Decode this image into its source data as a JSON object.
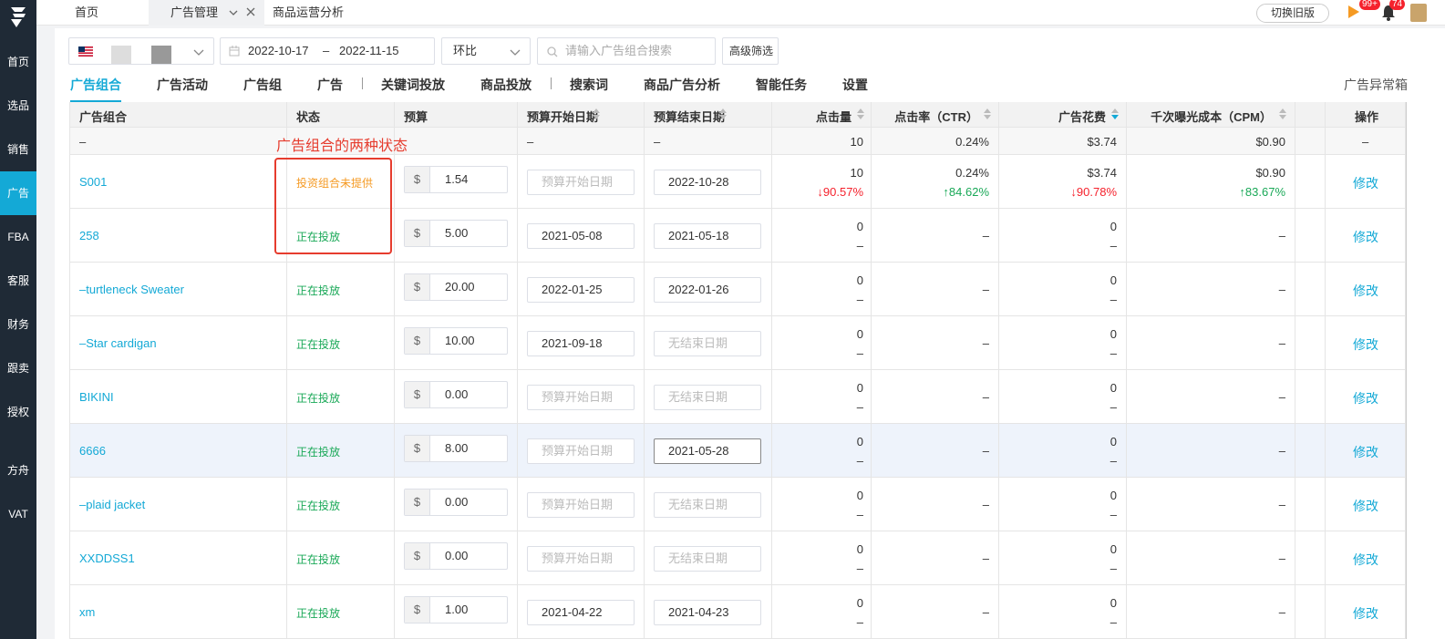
{
  "sidebar": {
    "items": [
      {
        "label": "首页"
      },
      {
        "label": "选品"
      },
      {
        "label": "销售"
      },
      {
        "label": "广告"
      },
      {
        "label": "FBA"
      },
      {
        "label": "客服"
      },
      {
        "label": "财务"
      },
      {
        "label": "跟卖"
      },
      {
        "label": "授权"
      },
      {
        "label": "方舟"
      },
      {
        "label": "VAT"
      }
    ],
    "active": "广告"
  },
  "topbar": {
    "tabs": [
      {
        "label": "首页"
      },
      {
        "label": "广告管理"
      },
      {
        "label": "商品运营分析"
      }
    ],
    "active_tab": "广告管理",
    "switch_old": "切换旧版",
    "badge_a": "99+",
    "badge_b": "74"
  },
  "filters": {
    "date_start": "2022-10-17",
    "date_sep": "–",
    "date_end": "2022-11-15",
    "compare": "环比",
    "search_placeholder": "请输入广告组合搜索",
    "advanced": "高级筛选"
  },
  "subtabs": [
    "广告组合",
    "广告活动",
    "广告组",
    "广告",
    "关键词投放",
    "商品投放",
    "搜索词",
    "商品广告分析",
    "智能任务",
    "设置"
  ],
  "active_subtab": "广告组合",
  "anomaly_box": "广告异常箱",
  "table": {
    "headers": {
      "portfolio": "广告组合",
      "status": "状态",
      "budget": "预算",
      "start": "预算开始日期",
      "end": "预算结束日期",
      "clicks": "点击量",
      "ctr": "点击率（CTR）",
      "spend": "广告花费",
      "cpm": "千次曝光成本（CPM）",
      "ops": "操作"
    },
    "summary": {
      "portfolio": "–",
      "start": "–",
      "end": "–",
      "clicks": "10",
      "ctr": "0.24%",
      "spend": "$3.74",
      "cpm": "$0.90",
      "ops": "–"
    },
    "currency": "$",
    "edit_label": "修改",
    "rows": [
      {
        "name": "S001",
        "status": "投资组合未提供",
        "status_type": "orange",
        "budget": "1.54",
        "start": "预算开始日期",
        "start_ph": true,
        "end": "2022-10-28",
        "end_ph": false,
        "clicks": "10",
        "clicks_cmp": "↓90.57%",
        "clicks_dir": "down",
        "ctr": "0.24%",
        "ctr_cmp": "↑84.62%",
        "ctr_dir": "up",
        "spend": "$3.74",
        "spend_cmp": "↓90.78%",
        "spend_dir": "down",
        "cpm": "$0.90",
        "cpm_cmp": "↑83.67%",
        "cpm_dir": "up"
      },
      {
        "name": "258",
        "status": "正在投放",
        "status_type": "green",
        "budget": "5.00",
        "start": "2021-05-08",
        "start_ph": false,
        "end": "2021-05-18",
        "end_ph": false,
        "clicks": "0",
        "clicks_cmp": "–",
        "ctr": "–",
        "spend": "0",
        "spend_cmp": "–",
        "cpm": "–"
      },
      {
        "name": "–turtleneck Sweater",
        "status": "正在投放",
        "status_type": "green",
        "budget": "20.00",
        "start": "2022-01-25",
        "start_ph": false,
        "end": "2022-01-26",
        "end_ph": false,
        "clicks": "0",
        "clicks_cmp": "–",
        "ctr": "–",
        "spend": "0",
        "spend_cmp": "–",
        "cpm": "–"
      },
      {
        "name": "–Star cardigan",
        "status": "正在投放",
        "status_type": "green",
        "budget": "10.00",
        "start": "2021-09-18",
        "start_ph": false,
        "end": "无结束日期",
        "end_ph": true,
        "clicks": "0",
        "clicks_cmp": "–",
        "ctr": "–",
        "spend": "0",
        "spend_cmp": "–",
        "cpm": "–"
      },
      {
        "name": "BIKINI",
        "status": "正在投放",
        "status_type": "green",
        "budget": "0.00",
        "start": "预算开始日期",
        "start_ph": true,
        "end": "无结束日期",
        "end_ph": true,
        "clicks": "0",
        "clicks_cmp": "–",
        "ctr": "–",
        "spend": "0",
        "spend_cmp": "–",
        "cpm": "–"
      },
      {
        "name": "6666",
        "status": "正在投放",
        "status_type": "green",
        "budget": "8.00",
        "start": "预算开始日期",
        "start_ph": true,
        "end": "2021-05-28",
        "end_ph": false,
        "clicks": "0",
        "clicks_cmp": "–",
        "ctr": "–",
        "spend": "0",
        "spend_cmp": "–",
        "cpm": "–",
        "highlight": true
      },
      {
        "name": "–plaid jacket",
        "status": "正在投放",
        "status_type": "green",
        "budget": "0.00",
        "start": "预算开始日期",
        "start_ph": true,
        "end": "无结束日期",
        "end_ph": true,
        "clicks": "0",
        "clicks_cmp": "–",
        "ctr": "–",
        "spend": "0",
        "spend_cmp": "–",
        "cpm": "–"
      },
      {
        "name": "XXDDSS1",
        "status": "正在投放",
        "status_type": "green",
        "budget": "0.00",
        "start": "预算开始日期",
        "start_ph": true,
        "end": "无结束日期",
        "end_ph": true,
        "clicks": "0",
        "clicks_cmp": "–",
        "ctr": "–",
        "spend": "0",
        "spend_cmp": "–",
        "cpm": "–"
      },
      {
        "name": "xm",
        "status": "正在投放",
        "status_type": "green",
        "budget": "1.00",
        "start": "2021-04-22",
        "start_ph": false,
        "end": "2021-04-23",
        "end_ph": false,
        "clicks": "0",
        "clicks_cmp": "–",
        "ctr": "–",
        "spend": "0",
        "spend_cmp": "–",
        "cpm": "–"
      }
    ]
  },
  "annotation": "广告组合的两种状态",
  "colors": {
    "accent": "#14a9d6",
    "green": "#19a857",
    "orange": "#f59a23",
    "red": "#f5222d",
    "annotation": "#e63c2e"
  }
}
